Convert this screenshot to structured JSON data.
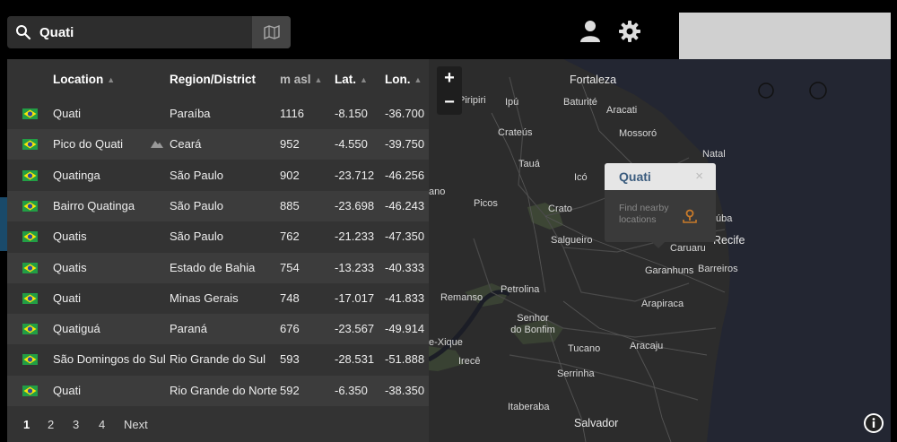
{
  "search": {
    "value": "Quati",
    "placeholder": ""
  },
  "icons": {
    "search": "search-icon",
    "map": "map-icon",
    "user": "user-icon",
    "settings": "gear-icon",
    "info": "info-icon",
    "mountain": "mountain-icon",
    "flag": "brazil-flag-icon"
  },
  "results": {
    "headers": {
      "location": "Location",
      "region": "Region/District",
      "masl": "m asl",
      "lat": "Lat.",
      "lon": "Lon."
    },
    "rows": [
      {
        "location": "Quati",
        "region": "Paraíba",
        "masl": "1116",
        "lat": "-8.150",
        "lon": "-36.700",
        "mountain": false
      },
      {
        "location": "Pico do Quati",
        "region": "Ceará",
        "masl": "952",
        "lat": "-4.550",
        "lon": "-39.750",
        "mountain": true
      },
      {
        "location": "Quatinga",
        "region": "São Paulo",
        "masl": "902",
        "lat": "-23.712",
        "lon": "-46.256",
        "mountain": false
      },
      {
        "location": "Bairro Quatinga",
        "region": "São Paulo",
        "masl": "885",
        "lat": "-23.698",
        "lon": "-46.243",
        "mountain": false
      },
      {
        "location": "Quatis",
        "region": "São Paulo",
        "masl": "762",
        "lat": "-21.233",
        "lon": "-47.350",
        "mountain": false
      },
      {
        "location": "Quatis",
        "region": "Estado de Bahia",
        "masl": "754",
        "lat": "-13.233",
        "lon": "-40.333",
        "mountain": false
      },
      {
        "location": "Quati",
        "region": "Minas Gerais",
        "masl": "748",
        "lat": "-17.017",
        "lon": "-41.833",
        "mountain": false
      },
      {
        "location": "Quatiguá",
        "region": "Paraná",
        "masl": "676",
        "lat": "-23.567",
        "lon": "-49.914",
        "mountain": false
      },
      {
        "location": "São Domingos do Sul",
        "region": "Rio Grande do Sul",
        "masl": "593",
        "lat": "-28.531",
        "lon": "-51.888",
        "mountain": false
      },
      {
        "location": "Quati",
        "region": "Rio Grande do Norte",
        "masl": "592",
        "lat": "-6.350",
        "lon": "-38.350",
        "mountain": false
      }
    ],
    "pagination": {
      "pages": [
        "1",
        "2",
        "3",
        "4"
      ],
      "active": "1",
      "next": "Next"
    }
  },
  "map": {
    "zoom_in": "+",
    "zoom_out": "−",
    "cities": [
      "Fortaleza",
      "Piripiri",
      "Ipú",
      "Baturité",
      "Aracati",
      "Crateús",
      "Mossoró",
      "Tauá",
      "Natal",
      "Icó",
      "ano",
      "Picos",
      "Crato",
      "úba",
      "Recife",
      "Salgueiro",
      "Caruaru",
      "Garanhuns",
      "Barreiros",
      "Petrolina",
      "Remanso",
      "Arapiraca",
      "Senhor do Bonfim",
      "Tucano",
      "Aracaju",
      "e-Xique",
      "Irecê",
      "Serrinha",
      "Itaberaba",
      "Salvador"
    ],
    "colors": {
      "land": "#2c2c2c",
      "sea": "#222531",
      "green": "#3c4536",
      "road": "#555"
    }
  },
  "popup": {
    "title": "Quati",
    "close": "×",
    "action": "Find nearby locations"
  }
}
